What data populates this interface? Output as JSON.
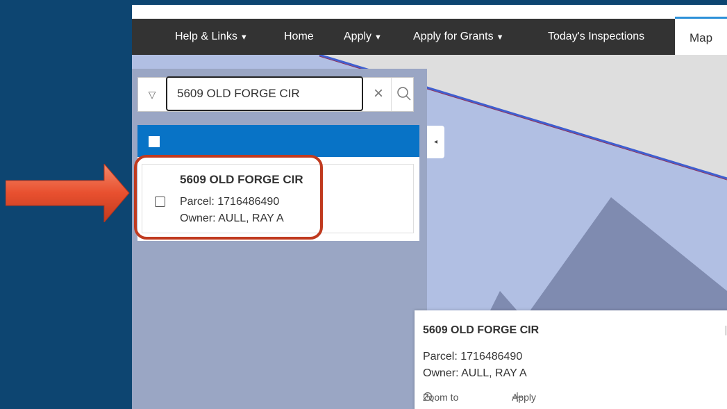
{
  "navbar": {
    "items": [
      {
        "label": "Help & Links",
        "caret": "▼"
      },
      {
        "label": "Home",
        "caret": ""
      },
      {
        "label": "Apply",
        "caret": "▼"
      },
      {
        "label": "Apply for Grants",
        "caret": "▼"
      },
      {
        "label": "Today's Inspections",
        "caret": ""
      }
    ],
    "active_tab": "Map"
  },
  "search": {
    "value": "5609 OLD FORGE CIR",
    "clear_glyph": "×",
    "filter_glyph": "▽"
  },
  "results": {
    "items": [
      {
        "title": "5609 OLD FORGE CIR",
        "parcel": "Parcel: 1716486490",
        "owner": "Owner: AULL, RAY A"
      }
    ]
  },
  "panel": {
    "collapse_glyph": "◂"
  },
  "popup": {
    "title": "5609 OLD FORGE CIR",
    "parcel": "Parcel: 1716486490",
    "owner": "Owner: AULL, RAY A",
    "zoom_label": "Zoom to",
    "apply_label": "Apply"
  },
  "colors": {
    "page_background": "#0d4571",
    "navbar": "#333333",
    "map_parcel": "#b1bfe3",
    "map_building": "#7f8bb0",
    "results_header": "#0873c6",
    "highlight": "#c03a1f",
    "arrow": "#e8502f"
  }
}
